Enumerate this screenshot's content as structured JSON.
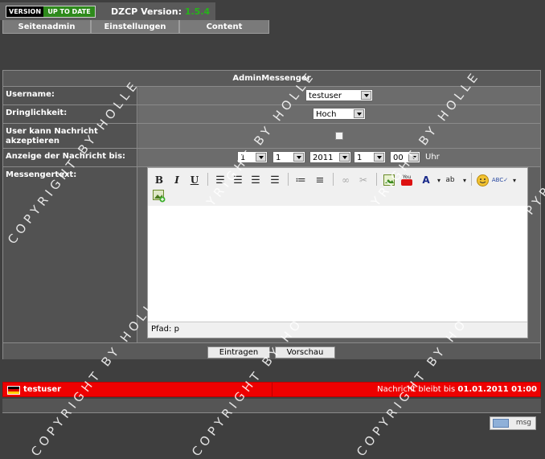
{
  "header": {
    "version_label": "VERSION",
    "version_status": "UP TO DATE",
    "dzcp_label": "DZCP Version:",
    "dzcp_version": "1.5.4"
  },
  "tabs": [
    {
      "label": "Seitenadmin"
    },
    {
      "label": "Einstellungen"
    },
    {
      "label": "Content"
    }
  ],
  "panel": {
    "title": "AdminMessenger",
    "username_label": "Username:",
    "username_value": "testuser",
    "priority_label": "Dringlichkeit:",
    "priority_value": "Hoch",
    "accept_label": "User kann Nachricht akzeptieren",
    "display_label": "Anzeige der Nachricht bis:",
    "day": "1",
    "month": "1",
    "year": "2011",
    "hour": "1",
    "minute": "00",
    "uhr": "Uhr",
    "message_label": "Messengertext:",
    "path_label": "Pfad: p",
    "submit_label": "Eintragen",
    "preview_label": "Vorschau"
  },
  "editor_toolbar": {
    "icons": [
      "bold-icon",
      "italic-icon",
      "underline-icon",
      "align-left-icon",
      "align-center-icon",
      "align-right-icon",
      "align-justify-icon",
      "bullet-list-icon",
      "numbered-list-icon",
      "link-icon",
      "unlink-icon",
      "image-icon",
      "youtube-icon",
      "font-color-icon",
      "highlight-icon",
      "smiley-icon",
      "spellcheck-icon",
      "insert-image-icon"
    ]
  },
  "message_bar": {
    "user": "testuser",
    "info_prefix": "Nachricht bleibt bis",
    "info_date": "01.01.2011 01:00"
  },
  "msg_button": {
    "label": "msg"
  },
  "watermark": {
    "text": "COPYRIGHT BY HOLLE"
  },
  "colors": {
    "red_bar": "#ee0000",
    "version_ok": "#2e8a1c",
    "dzcp_version": "#27b31a"
  }
}
